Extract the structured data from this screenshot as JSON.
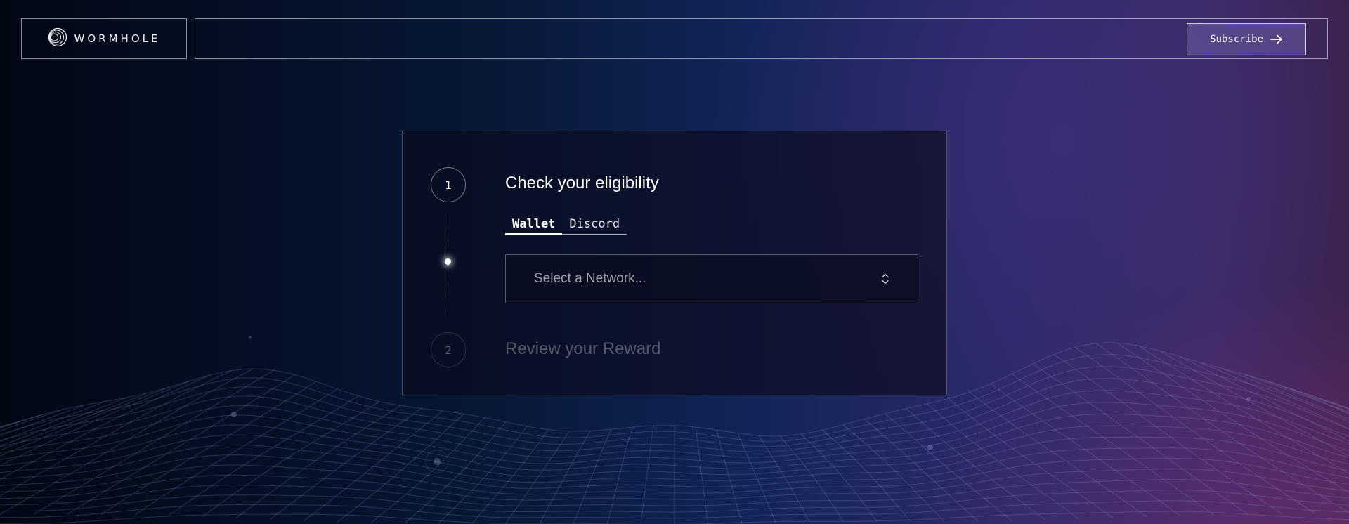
{
  "header": {
    "logo_text": "WORMHOLE",
    "subscribe_label": "Subscribe"
  },
  "steps": [
    {
      "number": "1",
      "title": "Check your eligibility"
    },
    {
      "number": "2",
      "title": "Review your Reward"
    }
  ],
  "tabs": [
    {
      "label": "Wallet",
      "active": true
    },
    {
      "label": "Discord",
      "active": false
    }
  ],
  "network_select": {
    "placeholder": "Select a Network..."
  },
  "icons": {
    "logo": "wormhole-logo-icon",
    "subscribe": "arrow-right-icon",
    "select": "chevron-up-down-icon"
  },
  "colors": {
    "background_left": "#020714",
    "background_mid": "#122457",
    "background_right": "#3b2350",
    "button_fill": "#5a4f8f"
  }
}
